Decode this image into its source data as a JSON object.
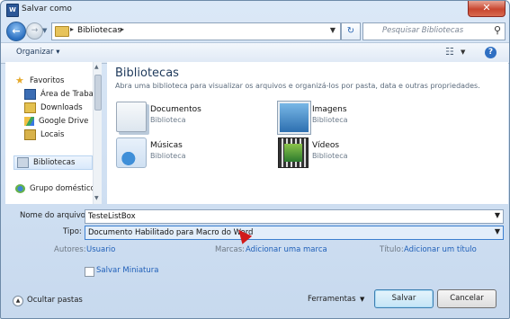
{
  "window": {
    "title": "Salvar como",
    "close_label": "✕"
  },
  "address": {
    "crumb": "Bibliotecas",
    "search_placeholder": "Pesquisar Bibliotecas"
  },
  "toolbar": {
    "organize": "Organizar ▾"
  },
  "nav": {
    "items": [
      {
        "label": "Favoritos",
        "icon": "star-icon"
      },
      {
        "label": "Área de Trabalh",
        "icon": "desktop-icon"
      },
      {
        "label": "Downloads",
        "icon": "downloads-icon"
      },
      {
        "label": "Google Drive",
        "icon": "google-drive-icon"
      },
      {
        "label": "Locais",
        "icon": "folder-icon"
      },
      {
        "label": "Bibliotecas",
        "icon": "library-icon"
      },
      {
        "label": "Grupo doméstico",
        "icon": "homegroup-icon"
      }
    ]
  },
  "main": {
    "title": "Bibliotecas",
    "subtitle": "Abra uma biblioteca para visualizar os arquivos e organizá-los por pasta, data e outras propriedades.",
    "libraries": [
      {
        "name": "Documentos",
        "type": "Biblioteca"
      },
      {
        "name": "Imagens",
        "type": "Biblioteca"
      },
      {
        "name": "Músicas",
        "type": "Biblioteca"
      },
      {
        "name": "Vídeos",
        "type": "Biblioteca"
      }
    ]
  },
  "form": {
    "filename_label": "Nome do arquivo:",
    "filename_value": "TesteListBox",
    "type_label": "Tipo:",
    "type_value": "Documento Habilitado para Macro do Word",
    "authors_label": "Autores:",
    "authors_value": "Usuario",
    "tags_label": "Marcas:",
    "tags_value": "Adicionar uma marca",
    "title_label": "Título:",
    "title_value": "Adicionar um título",
    "thumbnail_label": "Salvar Miniatura"
  },
  "footer": {
    "hide_folders": "Ocultar pastas",
    "tools": "Ferramentas",
    "save": "Salvar",
    "cancel": "Cancelar"
  }
}
